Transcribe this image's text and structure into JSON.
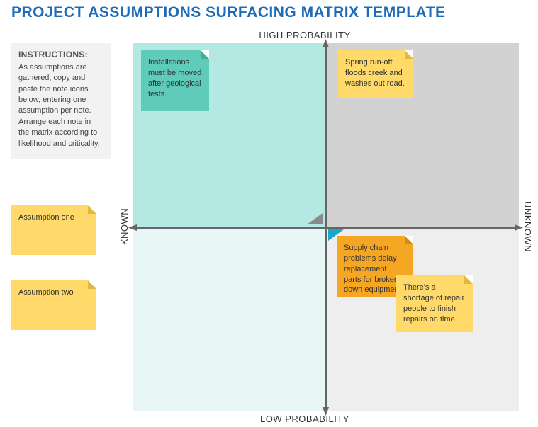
{
  "title": "PROJECT ASSUMPTIONS SURFACING MATRIX TEMPLATE",
  "axes": {
    "top": "HIGH PROBABILITY",
    "bottom": "LOW PROBABILITY",
    "left": "KNOWN",
    "right": "UNKNOWN"
  },
  "instructions": {
    "heading": "INSTRUCTIONS:",
    "body": "As assumptions are gathered, copy and paste the note icons below, entering one assumption per note. Arrange each note in the matrix according to likelihood and criticality."
  },
  "palette": {
    "note1": "Assumption one",
    "note2": "Assumption two"
  },
  "notes": {
    "installations": "Installations must be moved after geological tests.",
    "spring": "Spring run-off floods creek and washes out road.",
    "supply": "Supply chain problems delay replacement parts for broken down equipment.",
    "shortage": "There's a shortage of repair people to finish repairs on time."
  },
  "colors": {
    "title": "#1e6bb8",
    "q_tl": "#b3e9e2",
    "q_tr": "#d2d2d2",
    "q_bl": "#e8f7f5",
    "q_br": "#eeeeee",
    "note_yellow": "#ffd96a",
    "note_teal": "#5fccb9",
    "note_orange": "#f5a623",
    "accent_blue": "#1ca4c9"
  }
}
